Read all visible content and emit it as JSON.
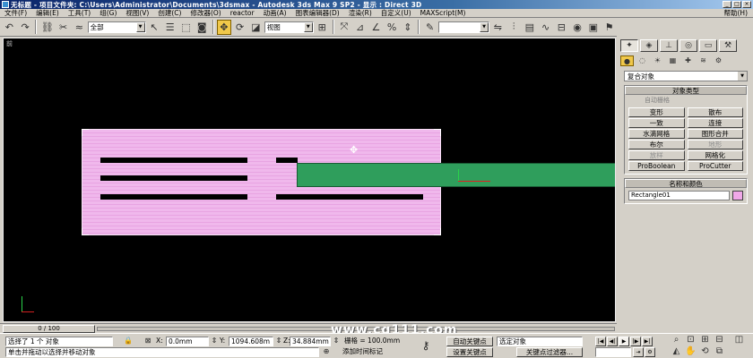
{
  "window": {
    "title": "无标题     - 项目文件夹: C:\\Users\\Administrator\\Documents\\3dsmax     - Autodesk 3ds Max 9 SP2     - 显示 : Direct 3D",
    "buttons": [
      "_",
      "□",
      "×"
    ]
  },
  "menubar": {
    "items": [
      "文件(F)",
      "编辑(E)",
      "工具(T)",
      "组(G)",
      "视图(V)",
      "创建(C)",
      "修改器(O)",
      "reactor",
      "动画(A)",
      "图表编辑器(D)",
      "渲染(R)",
      "自定义(U)",
      "MAXScript(M)"
    ],
    "help": "帮助(H)"
  },
  "toolbar": {
    "selection_filter": "全部",
    "coord_system": "视图"
  },
  "viewport": {
    "label": "前"
  },
  "command_panel": {
    "category_dropdown": "复合对象",
    "object_type": {
      "title": "对象类型",
      "autogrid": "自动栅格",
      "buttons": [
        {
          "label": "变形",
          "enabled": true
        },
        {
          "label": "散布",
          "enabled": true
        },
        {
          "label": "一致",
          "enabled": true
        },
        {
          "label": "连接",
          "enabled": true
        },
        {
          "label": "水滴网格",
          "enabled": true
        },
        {
          "label": "图形合并",
          "enabled": true
        },
        {
          "label": "布尔",
          "enabled": true
        },
        {
          "label": "地形",
          "enabled": false
        },
        {
          "label": "放样",
          "enabled": false
        },
        {
          "label": "网格化",
          "enabled": true
        },
        {
          "label": "ProBoolean",
          "enabled": true
        },
        {
          "label": "ProCutter",
          "enabled": true
        }
      ]
    },
    "name_color": {
      "title": "名称和颜色",
      "name": "Rectangle01",
      "color": "#f0a8e8"
    }
  },
  "timeline": {
    "frame_display": "0 / 100"
  },
  "status": {
    "selection": "选择了 1 个 对象",
    "prompt": "单击并拖动以选择并移动对象",
    "x_label": "X:",
    "x_value": "0.0mm",
    "y_label": "Y:",
    "y_value": "1094.608m",
    "z_label": "Z:",
    "z_value": "34.884mm",
    "grid": "栅格 = 100.0mm",
    "add_time_tag": "添加时间标记",
    "auto_key": "自动关键点",
    "set_key": "设置关键点",
    "key_filter_dropdown": "选定对象",
    "key_filters": "关键点过滤器..."
  },
  "watermark": "www.cg111.com",
  "colors": {
    "pink_object": "#f0b8ec",
    "green_object": "#2f9e5c",
    "viewport_bg": "#000000",
    "active_tool": "#f0c84a"
  }
}
